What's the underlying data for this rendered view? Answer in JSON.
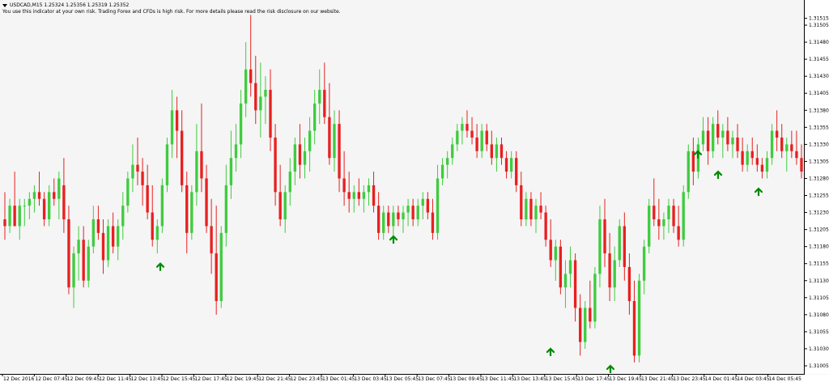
{
  "header": {
    "symbol_line": "USDCAD,M15  1.25324 1.25356 1.25319 1.25352",
    "disclaimer": "You use this indicator at your own risk. Trading Forex and CFDs is high risk. For more details please read the risk disclosure on our website."
  },
  "colors": {
    "bull": "#3fcc3f",
    "bear": "#e82020",
    "arrow": "#008a00",
    "background": "#f5f5f5"
  },
  "price_axis": {
    "labels": [
      "1.31515",
      "1.31505",
      "1.31480",
      "1.31455",
      "1.31430",
      "1.31405",
      "1.31380",
      "1.31355",
      "1.31330",
      "1.31305",
      "1.31280",
      "1.31255",
      "1.31230",
      "1.31205",
      "1.31180",
      "1.31155",
      "1.31130",
      "1.31105",
      "1.31080",
      "1.31055",
      "1.31030",
      "1.31005"
    ]
  },
  "time_axis": {
    "labels": [
      "12 Dec 2016",
      "12 Dec 07:45",
      "12 Dec 09:45",
      "12 Dec 11:45",
      "12 Dec 13:45",
      "12 Dec 15:45",
      "12 Dec 17:45",
      "12 Dec 19:45",
      "12 Dec 21:45",
      "12 Dec 23:45",
      "13 Dec 01:45",
      "13 Dec 03:45",
      "13 Dec 05:45",
      "13 Dec 07:45",
      "13 Dec 09:45",
      "13 Dec 11:45",
      "13 Dec 13:45",
      "13 Dec 15:45",
      "13 Dec 17:45",
      "13 Dec 19:45",
      "13 Dec 21:45",
      "13 Dec 23:45",
      "14 Dec 01:45",
      "14 Dec 03:45",
      "14 Dec 05:45"
    ]
  },
  "chart_data": {
    "type": "candlestick",
    "symbol": "USDCAD",
    "timeframe": "M15",
    "ylim": [
      1.31005,
      1.3153
    ],
    "candles": [
      {
        "o": 1.3122,
        "h": 1.3126,
        "l": 1.3119,
        "c": 1.3121
      },
      {
        "o": 1.3121,
        "h": 1.3125,
        "l": 1.312,
        "c": 1.3124
      },
      {
        "o": 1.3124,
        "h": 1.3129,
        "l": 1.3121,
        "c": 1.3121
      },
      {
        "o": 1.3121,
        "h": 1.3125,
        "l": 1.3119,
        "c": 1.3124
      },
      {
        "o": 1.3124,
        "h": 1.3125,
        "l": 1.3121,
        "c": 1.3124
      },
      {
        "o": 1.3124,
        "h": 1.3126,
        "l": 1.3122,
        "c": 1.3125
      },
      {
        "o": 1.3125,
        "h": 1.3127,
        "l": 1.3123,
        "c": 1.3126
      },
      {
        "o": 1.3126,
        "h": 1.3129,
        "l": 1.3124,
        "c": 1.3125
      },
      {
        "o": 1.3125,
        "h": 1.3126,
        "l": 1.3121,
        "c": 1.3122
      },
      {
        "o": 1.3122,
        "h": 1.3127,
        "l": 1.3121,
        "c": 1.3126
      },
      {
        "o": 1.3126,
        "h": 1.3128,
        "l": 1.3124,
        "c": 1.3125
      },
      {
        "o": 1.3125,
        "h": 1.3129,
        "l": 1.3122,
        "c": 1.3128
      },
      {
        "o": 1.3127,
        "h": 1.3131,
        "l": 1.312,
        "c": 1.3122
      },
      {
        "o": 1.3122,
        "h": 1.3124,
        "l": 1.3111,
        "c": 1.3112
      },
      {
        "o": 1.3112,
        "h": 1.3118,
        "l": 1.3109,
        "c": 1.3117
      },
      {
        "o": 1.3117,
        "h": 1.3121,
        "l": 1.3113,
        "c": 1.3119
      },
      {
        "o": 1.3119,
        "h": 1.3121,
        "l": 1.3112,
        "c": 1.3113
      },
      {
        "o": 1.3113,
        "h": 1.3119,
        "l": 1.3112,
        "c": 1.3118
      },
      {
        "o": 1.3118,
        "h": 1.3124,
        "l": 1.3117,
        "c": 1.3122
      },
      {
        "o": 1.3122,
        "h": 1.3124,
        "l": 1.3119,
        "c": 1.312
      },
      {
        "o": 1.312,
        "h": 1.3122,
        "l": 1.3114,
        "c": 1.3116
      },
      {
        "o": 1.3116,
        "h": 1.3122,
        "l": 1.3115,
        "c": 1.3121
      },
      {
        "o": 1.3121,
        "h": 1.3123,
        "l": 1.3117,
        "c": 1.3118
      },
      {
        "o": 1.3118,
        "h": 1.3122,
        "l": 1.3116,
        "c": 1.3121
      },
      {
        "o": 1.3121,
        "h": 1.3126,
        "l": 1.3119,
        "c": 1.3124
      },
      {
        "o": 1.3124,
        "h": 1.3129,
        "l": 1.3123,
        "c": 1.3128
      },
      {
        "o": 1.3128,
        "h": 1.3133,
        "l": 1.3126,
        "c": 1.313
      },
      {
        "o": 1.313,
        "h": 1.3134,
        "l": 1.3127,
        "c": 1.3129
      },
      {
        "o": 1.3129,
        "h": 1.3131,
        "l": 1.3124,
        "c": 1.3127
      },
      {
        "o": 1.3127,
        "h": 1.313,
        "l": 1.3122,
        "c": 1.3123
      },
      {
        "o": 1.3123,
        "h": 1.3127,
        "l": 1.3118,
        "c": 1.3119
      },
      {
        "o": 1.3119,
        "h": 1.3122,
        "l": 1.3117,
        "c": 1.3121
      },
      {
        "o": 1.3121,
        "h": 1.3128,
        "l": 1.312,
        "c": 1.3127
      },
      {
        "o": 1.3127,
        "h": 1.3134,
        "l": 1.3126,
        "c": 1.3133
      },
      {
        "o": 1.3133,
        "h": 1.3141,
        "l": 1.3131,
        "c": 1.3138
      },
      {
        "o": 1.3138,
        "h": 1.314,
        "l": 1.3131,
        "c": 1.3135
      },
      {
        "o": 1.3135,
        "h": 1.3138,
        "l": 1.3126,
        "c": 1.3127
      },
      {
        "o": 1.3127,
        "h": 1.3129,
        "l": 1.3117,
        "c": 1.312
      },
      {
        "o": 1.312,
        "h": 1.3127,
        "l": 1.3119,
        "c": 1.3126
      },
      {
        "o": 1.3126,
        "h": 1.3136,
        "l": 1.3124,
        "c": 1.3132
      },
      {
        "o": 1.3132,
        "h": 1.3139,
        "l": 1.3126,
        "c": 1.3128
      },
      {
        "o": 1.3128,
        "h": 1.313,
        "l": 1.312,
        "c": 1.3121
      },
      {
        "o": 1.3121,
        "h": 1.3125,
        "l": 1.3114,
        "c": 1.3117
      },
      {
        "o": 1.3117,
        "h": 1.3124,
        "l": 1.3108,
        "c": 1.311
      },
      {
        "o": 1.311,
        "h": 1.3121,
        "l": 1.3109,
        "c": 1.312
      },
      {
        "o": 1.312,
        "h": 1.313,
        "l": 1.3118,
        "c": 1.3127
      },
      {
        "o": 1.3127,
        "h": 1.3135,
        "l": 1.3125,
        "c": 1.3131
      },
      {
        "o": 1.3131,
        "h": 1.3136,
        "l": 1.3129,
        "c": 1.3133
      },
      {
        "o": 1.3133,
        "h": 1.3141,
        "l": 1.3131,
        "c": 1.3139
      },
      {
        "o": 1.3139,
        "h": 1.3148,
        "l": 1.3137,
        "c": 1.3144
      },
      {
        "o": 1.3144,
        "h": 1.3152,
        "l": 1.314,
        "c": 1.3142
      },
      {
        "o": 1.3142,
        "h": 1.3146,
        "l": 1.3136,
        "c": 1.3138
      },
      {
        "o": 1.3138,
        "h": 1.3145,
        "l": 1.3134,
        "c": 1.314
      },
      {
        "o": 1.314,
        "h": 1.3143,
        "l": 1.3136,
        "c": 1.3141
      },
      {
        "o": 1.3141,
        "h": 1.3144,
        "l": 1.3132,
        "c": 1.3134
      },
      {
        "o": 1.3134,
        "h": 1.3136,
        "l": 1.3124,
        "c": 1.3126
      },
      {
        "o": 1.3126,
        "h": 1.313,
        "l": 1.3121,
        "c": 1.3122
      },
      {
        "o": 1.3122,
        "h": 1.3127,
        "l": 1.312,
        "c": 1.3126
      },
      {
        "o": 1.3126,
        "h": 1.3131,
        "l": 1.3124,
        "c": 1.3129
      },
      {
        "o": 1.3129,
        "h": 1.3134,
        "l": 1.3127,
        "c": 1.3133
      },
      {
        "o": 1.3133,
        "h": 1.3136,
        "l": 1.3128,
        "c": 1.313
      },
      {
        "o": 1.313,
        "h": 1.3134,
        "l": 1.3128,
        "c": 1.3132
      },
      {
        "o": 1.3132,
        "h": 1.3137,
        "l": 1.3129,
        "c": 1.3135
      },
      {
        "o": 1.3135,
        "h": 1.3141,
        "l": 1.3133,
        "c": 1.3139
      },
      {
        "o": 1.3139,
        "h": 1.3144,
        "l": 1.3136,
        "c": 1.3141
      },
      {
        "o": 1.3141,
        "h": 1.3145,
        "l": 1.3136,
        "c": 1.3137
      },
      {
        "o": 1.3137,
        "h": 1.3142,
        "l": 1.313,
        "c": 1.3131
      },
      {
        "o": 1.3131,
        "h": 1.3138,
        "l": 1.3129,
        "c": 1.3136
      },
      {
        "o": 1.3136,
        "h": 1.3138,
        "l": 1.3126,
        "c": 1.3128
      },
      {
        "o": 1.3128,
        "h": 1.3132,
        "l": 1.3124,
        "c": 1.3126
      },
      {
        "o": 1.3126,
        "h": 1.3129,
        "l": 1.3123,
        "c": 1.3125
      },
      {
        "o": 1.3125,
        "h": 1.3127,
        "l": 1.3123,
        "c": 1.3126
      },
      {
        "o": 1.3126,
        "h": 1.3128,
        "l": 1.3124,
        "c": 1.3125
      },
      {
        "o": 1.3125,
        "h": 1.3127,
        "l": 1.3123,
        "c": 1.3126
      },
      {
        "o": 1.3126,
        "h": 1.3128,
        "l": 1.3124,
        "c": 1.3127
      },
      {
        "o": 1.3127,
        "h": 1.3129,
        "l": 1.3123,
        "c": 1.3124
      },
      {
        "o": 1.3124,
        "h": 1.3126,
        "l": 1.3119,
        "c": 1.312
      },
      {
        "o": 1.312,
        "h": 1.3124,
        "l": 1.3119,
        "c": 1.3123
      },
      {
        "o": 1.3123,
        "h": 1.3124,
        "l": 1.312,
        "c": 1.3121
      },
      {
        "o": 1.3121,
        "h": 1.3124,
        "l": 1.3119,
        "c": 1.3123
      },
      {
        "o": 1.3123,
        "h": 1.3124,
        "l": 1.3121,
        "c": 1.3122
      },
      {
        "o": 1.3122,
        "h": 1.3124,
        "l": 1.312,
        "c": 1.3123
      },
      {
        "o": 1.3123,
        "h": 1.3125,
        "l": 1.3121,
        "c": 1.3124
      },
      {
        "o": 1.3124,
        "h": 1.3125,
        "l": 1.3121,
        "c": 1.3122
      },
      {
        "o": 1.3122,
        "h": 1.3125,
        "l": 1.3121,
        "c": 1.3124
      },
      {
        "o": 1.3124,
        "h": 1.3126,
        "l": 1.3122,
        "c": 1.3125
      },
      {
        "o": 1.3125,
        "h": 1.3126,
        "l": 1.3122,
        "c": 1.3123
      },
      {
        "o": 1.3123,
        "h": 1.3125,
        "l": 1.3119,
        "c": 1.312
      },
      {
        "o": 1.312,
        "h": 1.313,
        "l": 1.3119,
        "c": 1.3128
      },
      {
        "o": 1.3128,
        "h": 1.3131,
        "l": 1.3127,
        "c": 1.313
      },
      {
        "o": 1.313,
        "h": 1.3132,
        "l": 1.3128,
        "c": 1.3131
      },
      {
        "o": 1.3131,
        "h": 1.3134,
        "l": 1.313,
        "c": 1.3133
      },
      {
        "o": 1.3133,
        "h": 1.3136,
        "l": 1.3132,
        "c": 1.3135
      },
      {
        "o": 1.3135,
        "h": 1.3137,
        "l": 1.3133,
        "c": 1.3136
      },
      {
        "o": 1.3136,
        "h": 1.3138,
        "l": 1.3134,
        "c": 1.3135
      },
      {
        "o": 1.3135,
        "h": 1.3137,
        "l": 1.3133,
        "c": 1.3134
      },
      {
        "o": 1.3134,
        "h": 1.3136,
        "l": 1.3131,
        "c": 1.3132
      },
      {
        "o": 1.3132,
        "h": 1.3136,
        "l": 1.3131,
        "c": 1.3135
      },
      {
        "o": 1.3135,
        "h": 1.3136,
        "l": 1.3132,
        "c": 1.3133
      },
      {
        "o": 1.3133,
        "h": 1.3135,
        "l": 1.313,
        "c": 1.3131
      },
      {
        "o": 1.3131,
        "h": 1.3134,
        "l": 1.3129,
        "c": 1.3133
      },
      {
        "o": 1.3133,
        "h": 1.3134,
        "l": 1.313,
        "c": 1.3131
      },
      {
        "o": 1.3131,
        "h": 1.3132,
        "l": 1.3128,
        "c": 1.3129
      },
      {
        "o": 1.3129,
        "h": 1.3132,
        "l": 1.3128,
        "c": 1.3131
      },
      {
        "o": 1.3131,
        "h": 1.3132,
        "l": 1.3126,
        "c": 1.3127
      },
      {
        "o": 1.3127,
        "h": 1.3129,
        "l": 1.3121,
        "c": 1.3122
      },
      {
        "o": 1.3122,
        "h": 1.3126,
        "l": 1.3121,
        "c": 1.3125
      },
      {
        "o": 1.3125,
        "h": 1.3126,
        "l": 1.3121,
        "c": 1.3122
      },
      {
        "o": 1.3122,
        "h": 1.3125,
        "l": 1.312,
        "c": 1.3124
      },
      {
        "o": 1.3124,
        "h": 1.3126,
        "l": 1.3122,
        "c": 1.3123
      },
      {
        "o": 1.3123,
        "h": 1.3124,
        "l": 1.3118,
        "c": 1.3119
      },
      {
        "o": 1.3119,
        "h": 1.3122,
        "l": 1.3115,
        "c": 1.3116
      },
      {
        "o": 1.3116,
        "h": 1.3119,
        "l": 1.3113,
        "c": 1.3118
      },
      {
        "o": 1.3118,
        "h": 1.3119,
        "l": 1.3111,
        "c": 1.3112
      },
      {
        "o": 1.3112,
        "h": 1.3116,
        "l": 1.3109,
        "c": 1.3114
      },
      {
        "o": 1.3114,
        "h": 1.3118,
        "l": 1.3112,
        "c": 1.3116
      },
      {
        "o": 1.3116,
        "h": 1.3117,
        "l": 1.3107,
        "c": 1.3109
      },
      {
        "o": 1.3109,
        "h": 1.3111,
        "l": 1.3102,
        "c": 1.3104
      },
      {
        "o": 1.3104,
        "h": 1.311,
        "l": 1.3103,
        "c": 1.3109
      },
      {
        "o": 1.3109,
        "h": 1.3113,
        "l": 1.3106,
        "c": 1.3107
      },
      {
        "o": 1.3107,
        "h": 1.3115,
        "l": 1.3106,
        "c": 1.3114
      },
      {
        "o": 1.3114,
        "h": 1.3124,
        "l": 1.3112,
        "c": 1.3122
      },
      {
        "o": 1.3122,
        "h": 1.3125,
        "l": 1.3115,
        "c": 1.3117
      },
      {
        "o": 1.3117,
        "h": 1.312,
        "l": 1.311,
        "c": 1.3112
      },
      {
        "o": 1.3112,
        "h": 1.3118,
        "l": 1.311,
        "c": 1.3116
      },
      {
        "o": 1.3116,
        "h": 1.3122,
        "l": 1.3115,
        "c": 1.3121
      },
      {
        "o": 1.3121,
        "h": 1.3123,
        "l": 1.3113,
        "c": 1.3115
      },
      {
        "o": 1.3115,
        "h": 1.3117,
        "l": 1.3108,
        "c": 1.311
      },
      {
        "o": 1.311,
        "h": 1.3113,
        "l": 1.3101,
        "c": 1.3102
      },
      {
        "o": 1.3102,
        "h": 1.3114,
        "l": 1.3101,
        "c": 1.3113
      },
      {
        "o": 1.3113,
        "h": 1.3119,
        "l": 1.3111,
        "c": 1.3118
      },
      {
        "o": 1.3118,
        "h": 1.3125,
        "l": 1.3117,
        "c": 1.3124
      },
      {
        "o": 1.3124,
        "h": 1.3128,
        "l": 1.3121,
        "c": 1.3122
      },
      {
        "o": 1.3122,
        "h": 1.3125,
        "l": 1.3119,
        "c": 1.3121
      },
      {
        "o": 1.3121,
        "h": 1.3123,
        "l": 1.3119,
        "c": 1.3122
      },
      {
        "o": 1.3122,
        "h": 1.3125,
        "l": 1.312,
        "c": 1.3124
      },
      {
        "o": 1.3124,
        "h": 1.3125,
        "l": 1.312,
        "c": 1.3121
      },
      {
        "o": 1.3121,
        "h": 1.3124,
        "l": 1.3118,
        "c": 1.3119
      },
      {
        "o": 1.3119,
        "h": 1.3127,
        "l": 1.3118,
        "c": 1.3126
      },
      {
        "o": 1.3126,
        "h": 1.3133,
        "l": 1.3125,
        "c": 1.3132
      },
      {
        "o": 1.3132,
        "h": 1.3134,
        "l": 1.3127,
        "c": 1.3129
      },
      {
        "o": 1.3129,
        "h": 1.3134,
        "l": 1.3128,
        "c": 1.3133
      },
      {
        "o": 1.3133,
        "h": 1.3137,
        "l": 1.3132,
        "c": 1.3135
      },
      {
        "o": 1.3135,
        "h": 1.3137,
        "l": 1.313,
        "c": 1.3132
      },
      {
        "o": 1.3132,
        "h": 1.3137,
        "l": 1.3131,
        "c": 1.3136
      },
      {
        "o": 1.3136,
        "h": 1.3138,
        "l": 1.3133,
        "c": 1.3134
      },
      {
        "o": 1.3134,
        "h": 1.3136,
        "l": 1.3131,
        "c": 1.3135
      },
      {
        "o": 1.3135,
        "h": 1.3137,
        "l": 1.3132,
        "c": 1.3133
      },
      {
        "o": 1.3133,
        "h": 1.3135,
        "l": 1.3131,
        "c": 1.3134
      },
      {
        "o": 1.3134,
        "h": 1.3136,
        "l": 1.3131,
        "c": 1.3132
      },
      {
        "o": 1.3132,
        "h": 1.3134,
        "l": 1.3129,
        "c": 1.313
      },
      {
        "o": 1.313,
        "h": 1.3133,
        "l": 1.3129,
        "c": 1.3132
      },
      {
        "o": 1.3132,
        "h": 1.3134,
        "l": 1.313,
        "c": 1.3131
      },
      {
        "o": 1.3131,
        "h": 1.3133,
        "l": 1.3129,
        "c": 1.313
      },
      {
        "o": 1.313,
        "h": 1.3131,
        "l": 1.3128,
        "c": 1.3129
      },
      {
        "o": 1.3129,
        "h": 1.3132,
        "l": 1.3128,
        "c": 1.3131
      },
      {
        "o": 1.3131,
        "h": 1.3136,
        "l": 1.313,
        "c": 1.3135
      },
      {
        "o": 1.3135,
        "h": 1.3138,
        "l": 1.3132,
        "c": 1.3134
      },
      {
        "o": 1.3134,
        "h": 1.3136,
        "l": 1.3131,
        "c": 1.3132
      },
      {
        "o": 1.3132,
        "h": 1.3134,
        "l": 1.3129,
        "c": 1.3133
      },
      {
        "o": 1.3133,
        "h": 1.3135,
        "l": 1.3131,
        "c": 1.3132
      },
      {
        "o": 1.3132,
        "h": 1.3135,
        "l": 1.313,
        "c": 1.3131
      },
      {
        "o": 1.3131,
        "h": 1.3133,
        "l": 1.3128,
        "c": 1.3129
      }
    ],
    "buy_arrows": [
      {
        "time": "12 Dec 15:30",
        "price": 1.31155
      },
      {
        "time": "13 Dec 05:00",
        "price": 1.31195
      },
      {
        "time": "13 Dec 15:00",
        "price": 1.3103
      },
      {
        "time": "13 Dec 18:00",
        "price": 1.31005
      },
      {
        "time": "14 Dec 00:30",
        "price": 1.3132
      },
      {
        "time": "14 Dec 01:30",
        "price": 1.3129
      },
      {
        "time": "14 Dec 03:30",
        "price": 1.31265
      }
    ]
  }
}
